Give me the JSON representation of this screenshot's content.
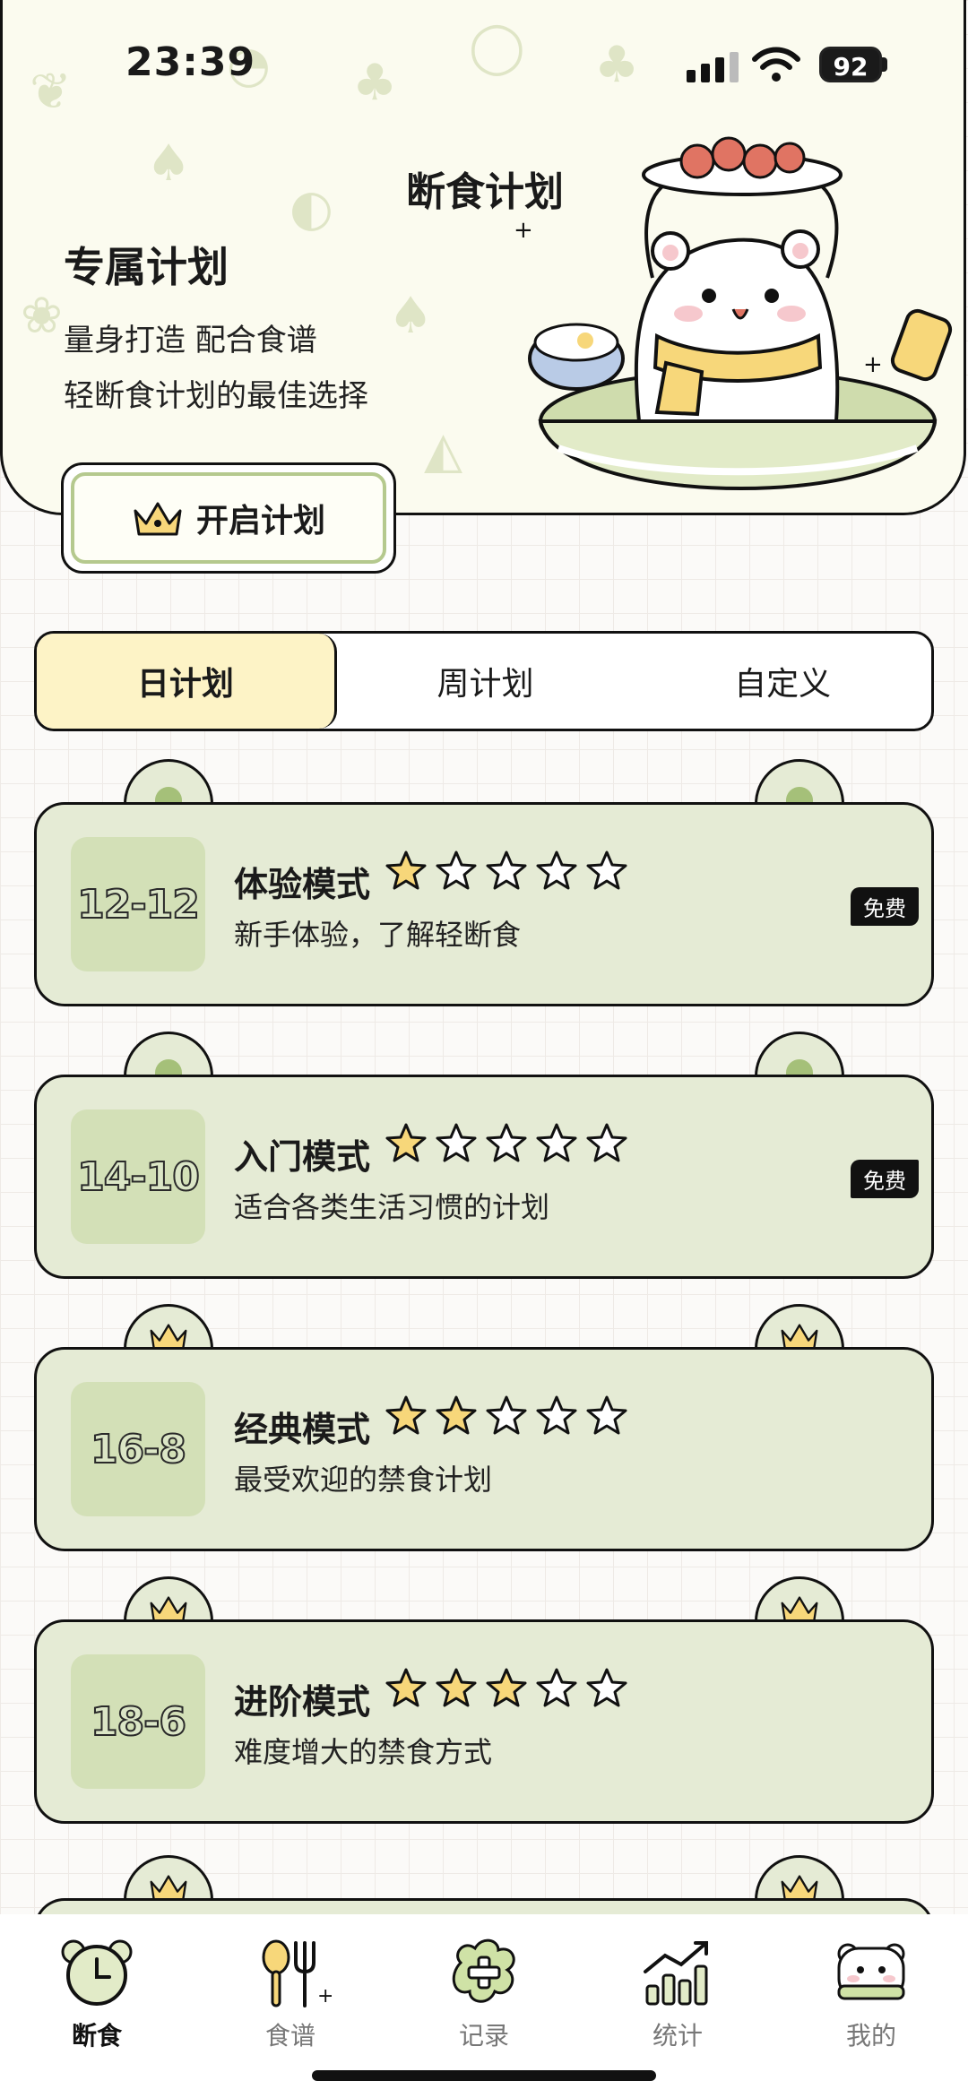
{
  "status_bar": {
    "time": "23:39",
    "battery": "92"
  },
  "header": {
    "page_title": "断食计划",
    "plan_title": "专属计划",
    "plan_lines": [
      "量身打造 配合食谱",
      "轻断食计划的最佳选择"
    ],
    "start_button_label": "开启计划"
  },
  "tabs": [
    {
      "label": "日计划",
      "active": true
    },
    {
      "label": "周计划",
      "active": false
    },
    {
      "label": "自定义",
      "active": false
    }
  ],
  "plans": [
    {
      "ratio": "12-12",
      "name": "体验模式",
      "stars": 1,
      "description": "新手体验，了解轻断食",
      "badge": "免费",
      "tab_icon": "dot"
    },
    {
      "ratio": "14-10",
      "name": "入门模式",
      "stars": 1,
      "description": "适合各类生活习惯的计划",
      "badge": "免费",
      "tab_icon": "dot"
    },
    {
      "ratio": "16-8",
      "name": "经典模式",
      "stars": 2,
      "description": "最受欢迎的禁食计划",
      "badge": "",
      "tab_icon": "crown"
    },
    {
      "ratio": "18-6",
      "name": "进阶模式",
      "stars": 3,
      "description": "难度增大的禁食方式",
      "badge": "",
      "tab_icon": "crown"
    }
  ],
  "nav": [
    {
      "label": "断食",
      "icon": "alarm-clock-icon",
      "active": true
    },
    {
      "label": "食谱",
      "icon": "utensils-icon",
      "active": false
    },
    {
      "label": "记录",
      "icon": "add-record-icon",
      "active": false
    },
    {
      "label": "统计",
      "icon": "chart-icon",
      "active": false
    },
    {
      "label": "我的",
      "icon": "bear-avatar-icon",
      "active": false
    }
  ],
  "colors": {
    "accent_green": "#e5ebd5",
    "tab_active": "#fdf3c6",
    "star_fill": "#f7d77a"
  }
}
